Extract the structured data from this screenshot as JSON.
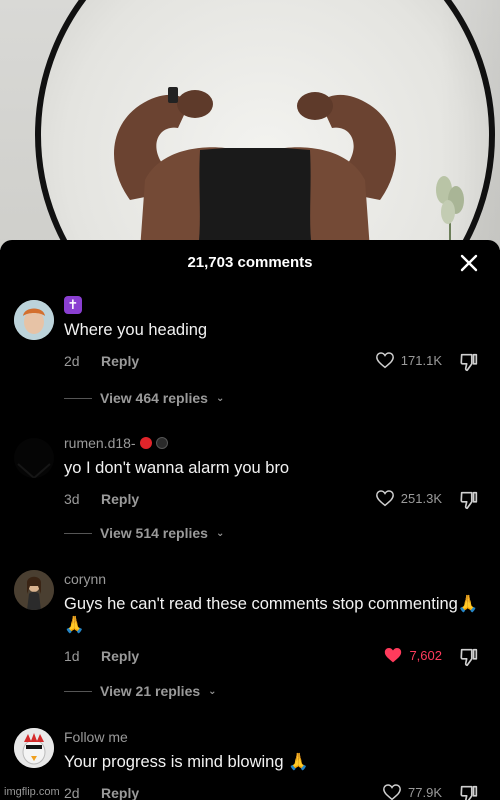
{
  "header": {
    "title": "21,703 comments"
  },
  "comments": [
    {
      "username": "",
      "badge": "✝",
      "text": "Where you heading",
      "time": "2d",
      "reply_label": "Reply",
      "likes": "171.1K",
      "liked": false,
      "view_replies": "View 464 replies"
    },
    {
      "username": "rumen.d18-",
      "text": "yo I don't wanna alarm you bro",
      "time": "3d",
      "reply_label": "Reply",
      "likes": "251.3K",
      "liked": false,
      "view_replies": "View 514 replies"
    },
    {
      "username": "corynn",
      "text": "Guys he can't read these comments stop commenting🙏🙏",
      "time": "1d",
      "reply_label": "Reply",
      "likes": "7,602",
      "liked": true,
      "view_replies": "View 21 replies"
    },
    {
      "username": "Follow me",
      "text": "Your progress is mind blowing 🙏",
      "time": "2d",
      "reply_label": "Reply",
      "likes": "77.9K",
      "liked": false
    }
  ],
  "colors": {
    "background": "#000000",
    "secondary_text": "#9a9a9a",
    "like_active": "#ff3b5c"
  },
  "icons": {
    "close": "close-icon",
    "like": "heart-icon",
    "dislike": "dislike-icon",
    "chevron": "chevron-down-icon"
  },
  "watermark": "imgflip.com"
}
